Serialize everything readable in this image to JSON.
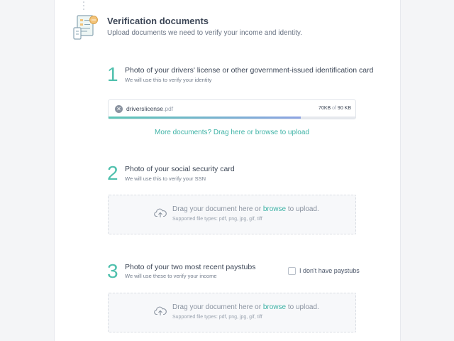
{
  "header": {
    "title": "Verification documents",
    "subtitle": "Upload documents we need to verify your income and identity."
  },
  "steps": [
    {
      "number": "1",
      "title": "Photo of your drivers' license or other government-issued identification card",
      "subtitle": "We will use this to verify your identity",
      "file": {
        "name": "driverslicense",
        "ext": ".pdf",
        "uploaded": "70KB",
        "of": "of",
        "total": "90 KB",
        "progress_fraction": 0.7778
      },
      "more_link": "More documents? Drag here or browse to upload"
    },
    {
      "number": "2",
      "title": "Photo of your social security card",
      "subtitle": "We will use this to verify your SSN",
      "drop_pre": "Drag your document here or ",
      "drop_link": "browse",
      "drop_post": " to upload.",
      "file_types": "Supported file types: pdf, png, jpg, gif, tiff"
    },
    {
      "number": "3",
      "title": "Photo of your two most recent paystubs",
      "subtitle": "We will use these to verify your income",
      "checkbox_label": "I don't have paystubs",
      "checkbox_checked": false,
      "drop_pre": "Drag your document here or ",
      "drop_link": "browse",
      "drop_post": " to upload.",
      "file_types": "Supported file types: pdf, png, jpg, gif, tiff"
    }
  ],
  "colors": {
    "accent": "#4fc0ad",
    "link": "#3fb3a6",
    "progress_end": "#8ea4e3"
  },
  "icons": {
    "header": "document-checklist-icon",
    "remove": "close-circle-icon",
    "upload": "cloud-upload-icon"
  }
}
